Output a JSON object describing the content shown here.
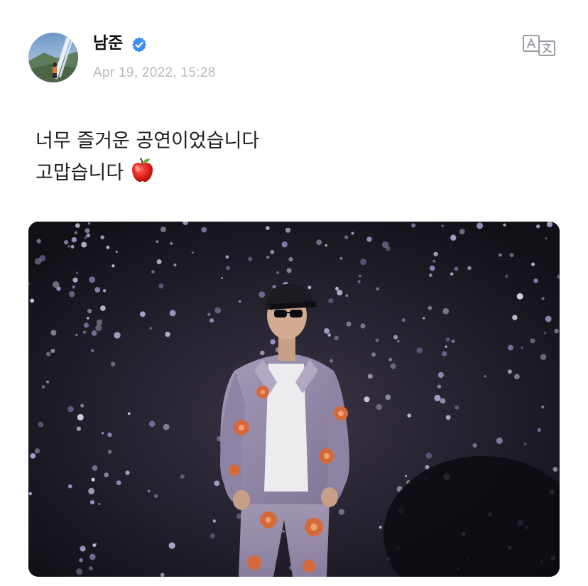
{
  "post": {
    "author_name": "남준",
    "verified_icon": "verified-check-icon",
    "timestamp": "Apr 19, 2022, 15:28",
    "translate_icon": "translate-icon",
    "text_line_1": "너무 즐거운 공연이었습니다",
    "text_line_2": "고맙습니다",
    "emoji": "red-apple-emoji",
    "photo_alt_icon": "concert-photo"
  },
  "colors": {
    "verified_blue": "#3a8ef5",
    "timestamp_gray": "#b7b9bf",
    "icon_gray": "#9a9ca2",
    "text": "#1d1d1f"
  }
}
